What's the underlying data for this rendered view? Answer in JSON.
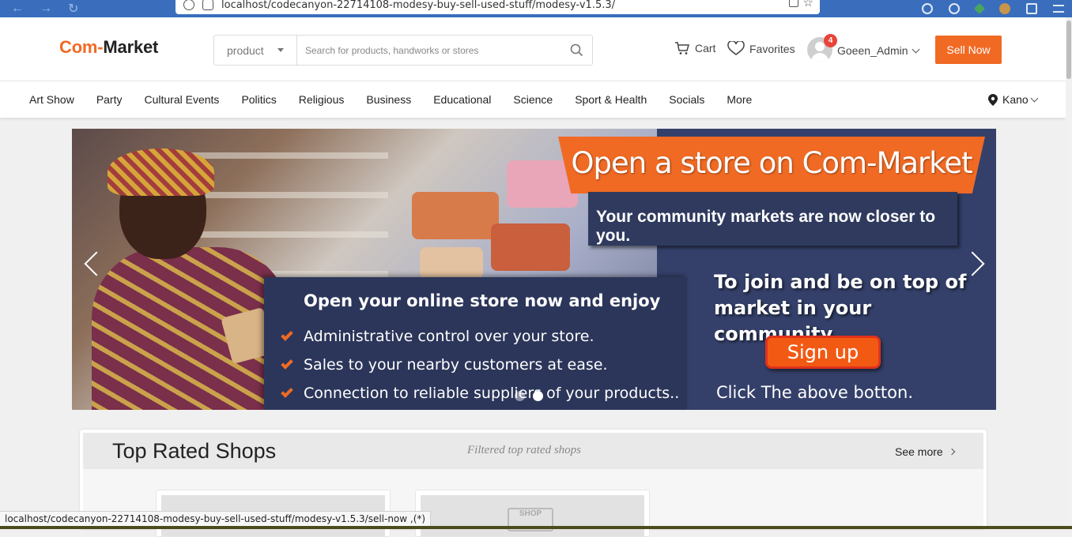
{
  "browser": {
    "url": "localhost/codecanyon-22714108-modesy-buy-sell-used-stuff/modesy-v1.5.3/"
  },
  "header": {
    "logo_part1": "Com-",
    "logo_part2": "Market",
    "search_category": "product",
    "search_placeholder": "Search for products, handworks or stores",
    "cart_label": "Cart",
    "favorites_label": "Favorites",
    "notification_count": "4",
    "username": "Goeen_Admin",
    "sell_button": "Sell Now"
  },
  "categories": [
    "Art Show",
    "Party",
    "Cultural Events",
    "Politics",
    "Religious",
    "Business",
    "Educational",
    "Science",
    "Sport & Health",
    "Socials",
    "More"
  ],
  "location": "Kano",
  "banner": {
    "title": "Open a store on Com-Market",
    "subtitle": "Your community markets are now closer to you.",
    "feature_title": "Open your online store now and enjoy",
    "features": [
      "Administrative control over your store.",
      "Sales to your nearby customers at ease.",
      "Connection to reliable suppliers of your products.."
    ],
    "join_line1": "To join  and be on top of",
    "join_line2": "market in your community",
    "signup_label": "Sign up",
    "click_text": "Click The above botton.",
    "slide_count": 2,
    "active_slide": 2
  },
  "top_rated": {
    "title": "Top Rated Shops",
    "subtitle": "Filtered top rated shops",
    "see_more": "See more",
    "shop_placeholder_label": "SHOP"
  },
  "status_bar": "localhost/codecanyon-22714108-modesy-buy-sell-used-stuff/modesy-v1.5.3/sell-now ,(*)",
  "colors": {
    "accent": "#f06a24",
    "banner_navy": "#2c365a",
    "browser_bar": "#3a6ebd"
  }
}
